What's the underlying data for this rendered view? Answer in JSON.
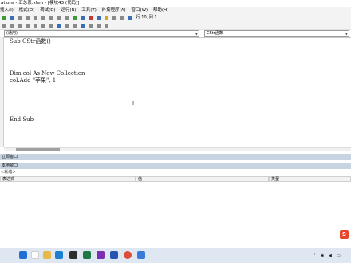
{
  "window": {
    "title": "ations - 汇总表.xlsm - [模块43 (代码)]"
  },
  "menu": [
    "插入(I)",
    "格式(O)",
    "调试(D)",
    "运行(R)",
    "工具(T)",
    "外接程序(A)",
    "窗口(W)",
    "帮助(H)"
  ],
  "toolbar": {
    "position": "行 10, 列 1"
  },
  "combos": {
    "object": "(通用)",
    "procedure": "CStr函数"
  },
  "code_lines": [
    "Sub CStr函数()",
    "Dim col As New Collection",
    "col.Add \"苹果\", 1",
    "End Sub"
  ],
  "panes": {
    "immediate": "立即窗口",
    "locals": "本地窗口",
    "locals_ctx": "<就绪>"
  },
  "watch": {
    "col_expr": "表达式",
    "col_value": "值",
    "col_type": "类型"
  },
  "taskbar": {
    "time_top": "",
    "wps_label": "S"
  },
  "colors": {
    "editor_bg": "#ffffff",
    "pane_header": "#c9d4e3",
    "taskbar_bg": "#dfe7f3"
  }
}
